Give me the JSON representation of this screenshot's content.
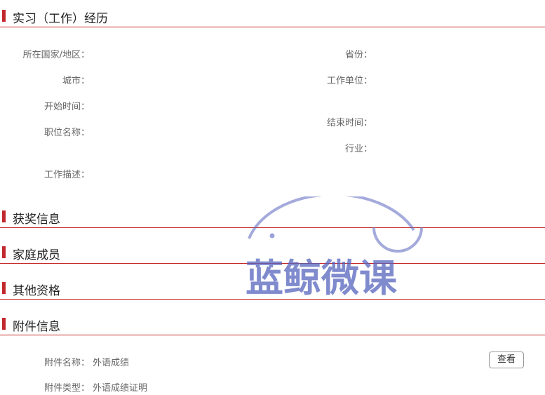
{
  "internship": {
    "title": "实习（工作）经历",
    "country_label": "所在国家/地区：",
    "province_label": "省份：",
    "city_label": "城市：",
    "employer_label": "工作单位：",
    "start_label": "开始时间：",
    "end_label": "结束时间：",
    "position_label": "职位名称：",
    "industry_label": "行业：",
    "description_label": "工作描述："
  },
  "awards": {
    "title": "获奖信息"
  },
  "family": {
    "title": "家庭成员"
  },
  "qualifications": {
    "title": "其他资格"
  },
  "attachments": {
    "title": "附件信息",
    "name_label": "附件名称：",
    "name_value": "外语成绩",
    "type_label": "附件类型：",
    "type_value": "外语成绩证明",
    "view_button": "查看"
  },
  "watermark": {
    "text": "蓝鲸微课",
    "color": "#5a64be"
  },
  "colors": {
    "accent": "#c0282d",
    "divider": "#c62828"
  }
}
